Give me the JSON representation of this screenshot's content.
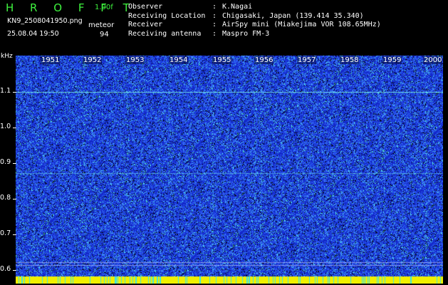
{
  "header": {
    "app_title": "H R O F F T",
    "version": "1.00f",
    "filename": "KN9_2508041950.png",
    "datetime": "25.08.04 19:50",
    "meteor_label": "meteor",
    "meteor_count": "94"
  },
  "info": [
    {
      "key": "Observer",
      "value": "K.Nagai"
    },
    {
      "key": "Receiving Location",
      "value": "Chigasaki, Japan (139.414 35.340)"
    },
    {
      "key": "Receiver",
      "value": "AirSpy mini (Miakejima VOR 108.65MHz)"
    },
    {
      "key": "Receiving antenna",
      "value": "Maspro FM-3"
    }
  ],
  "spectrogram": {
    "y_axis_label": "kHz",
    "y_ticks": [
      "1.1",
      "1.0",
      "0.9",
      "0.8",
      "0.7",
      "0.6"
    ],
    "x_ticks": [
      "1951",
      "1952",
      "1953",
      "1954",
      "1955",
      "1956",
      "1957",
      "1958",
      "1959",
      "2000"
    ],
    "colors": {
      "background": "#1428c8",
      "noise_light": "#3c78ff",
      "noise_bright": "#3ce6e6",
      "bottom_band": "#f0f000",
      "accent_text": "#3ef23e"
    }
  }
}
